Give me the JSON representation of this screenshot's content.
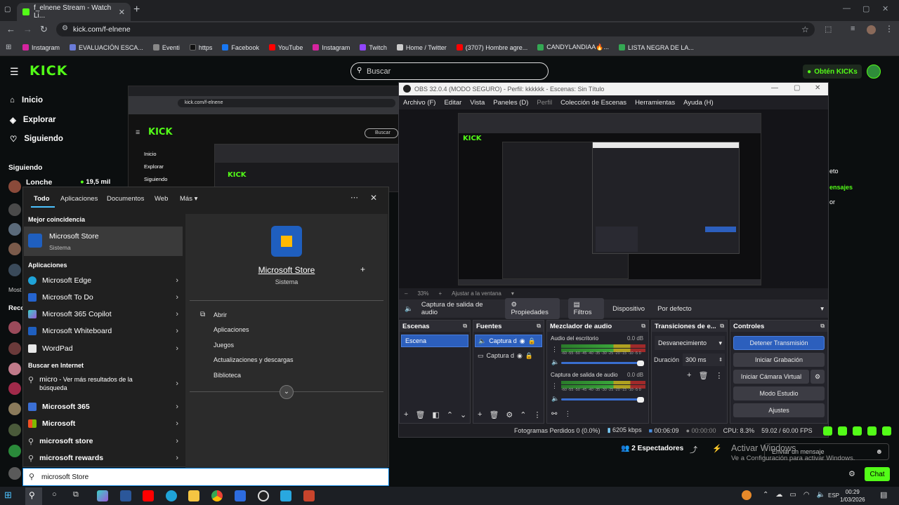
{
  "browser": {
    "tab_title": "f_elnene Stream - Watch Li...",
    "url": "kick.com/f-elnene",
    "bookmarks": [
      "Instagram",
      "EVALUACIÓN ESCA...",
      "Eventi",
      "https",
      "Facebook",
      "YouTube",
      "Instagram",
      "Twitch",
      "Home / Twitter",
      "(3707) Hombre agre...",
      "CANDYLANDIAA🔥...",
      "LISTA NEGRA DE LA..."
    ]
  },
  "kick": {
    "logo": "KICK",
    "search_placeholder": "Buscar",
    "kicks_button": "Obtén KICKs",
    "nav": [
      "Inicio",
      "Explorar",
      "Siguiendo"
    ],
    "following_heading": "Siguiendo",
    "followed_channel": "Lonche",
    "followed_viewers": "19,5 mil",
    "side_labels": [
      "Most",
      "Reco"
    ],
    "viewers": "2 Espectadores",
    "chat_placeholder": "Enviar un mensaje",
    "chat_button": "Chat",
    "right_fragments": [
      "eto",
      "ensajes",
      "or"
    ]
  },
  "nested": {
    "url": "kick.com/f-elnene",
    "nav": [
      "Inicio",
      "Explorar",
      "Siguiendo"
    ],
    "search": "Buscar"
  },
  "windows_search": {
    "tabs": [
      "Todo",
      "Aplicaciones",
      "Documentos",
      "Web",
      "Más"
    ],
    "best_match_heading": "Mejor coincidencia",
    "best_match": {
      "name": "Microsoft Store",
      "type": "Sistema"
    },
    "apps_heading": "Aplicaciones",
    "apps": [
      "Microsoft Edge",
      "Microsoft To Do",
      "Microsoft 365 Copilot",
      "Microsoft Whiteboard",
      "WordPad"
    ],
    "web_heading": "Buscar en Internet",
    "web_first": {
      "bold": "micro",
      "rest": " - Ver más resultados de la búsqueda"
    },
    "web": [
      "Microsoft 365",
      "Microsoft",
      "microsoft store",
      "microsoft rewards"
    ],
    "detail": {
      "name": "Microsoft Store",
      "type": "Sistema"
    },
    "actions": [
      "Abrir",
      "Aplicaciones",
      "Juegos",
      "Actualizaciones y descargas",
      "Biblioteca"
    ],
    "query": "microsoft Store"
  },
  "obs": {
    "title": "OBS 32.0.4 (MODO SEGURO) - Perfil: kkkkkk - Escenas: Sin Título",
    "menu": [
      "Archivo (F)",
      "Editar",
      "Vista",
      "Paneles (D)",
      "Perfil",
      "Colección de Escenas",
      "Herramientas",
      "Ayuda (H)"
    ],
    "zoom": "33%",
    "fit": "Ajustar a la ventana",
    "source_label": "Captura de salida de audio",
    "properties": "Propiedades",
    "filters": "Filtros",
    "device_label": "Dispositivo",
    "device_value": "Por defecto",
    "docks": {
      "scenes": "Escenas",
      "sources": "Fuentes",
      "mixer": "Mezclador de audio",
      "transitions": "Transiciones de e...",
      "controls": "Controles"
    },
    "scene_item": "Escena",
    "sources": [
      "Captura d",
      "Captura d"
    ],
    "mixer": [
      {
        "name": "Audio del escritorio",
        "db": "0.0 dB"
      },
      {
        "name": "Captura de salida de audio",
        "db": "0.0 dB"
      }
    ],
    "meter_scale": "-60 -55 -50 -45 -40 -35 -30 -25 -20 -15 -10 -5 0",
    "transition": "Desvanecimiento",
    "duration_label": "Duración",
    "duration_value": "300 ms",
    "controls": [
      "Detener Transmisión",
      "Iniciar Grabación",
      "Iniciar Cámara Virtual",
      "Modo Estudio",
      "Ajustes"
    ],
    "status": {
      "dropped": "Fotogramas Perdidos 0 (0.0%)",
      "bitrate": "6205 kbps",
      "stream_time": "00:06:09",
      "rec_time": "00:00:00",
      "cpu": "CPU: 8.3%",
      "fps": "59.02 / 60.00 FPS"
    }
  },
  "system": {
    "activate_line1": "Activar Windows",
    "activate_line2": "Ve a Configuración para activar Windows.",
    "lang": "ESP",
    "time": "00:29",
    "date": "1/03/2026"
  }
}
